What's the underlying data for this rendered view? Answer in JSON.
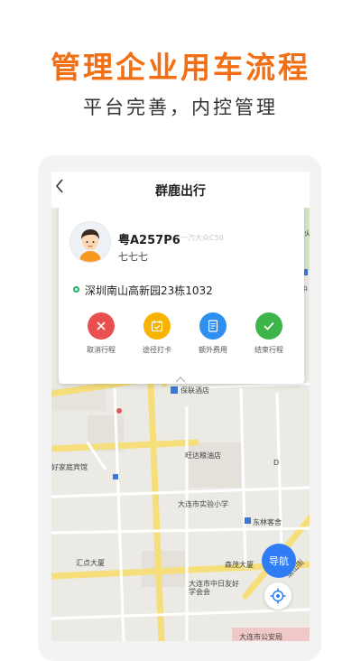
{
  "promo": {
    "headline": "管理企业用车流程",
    "subheadline": "平台完善，内控管理"
  },
  "app": {
    "title": "群鹿出行",
    "back_icon": "chevron-left-icon"
  },
  "trip_card": {
    "plate": "粤A257P6",
    "car_model": "一汽大众C50",
    "driver_name": "七七七",
    "address": "深圳南山高新园23栋1032",
    "actions": [
      {
        "label": "取消行程",
        "icon": "close-icon",
        "color": "#ea4f4f"
      },
      {
        "label": "途径打卡",
        "icon": "calendar-check-icon",
        "color": "#f6b400"
      },
      {
        "label": "额外费用",
        "icon": "receipt-icon",
        "color": "#2f8ff0"
      },
      {
        "label": "结束行程",
        "icon": "checkmark-icon",
        "color": "#3db54a"
      }
    ]
  },
  "map": {
    "labels": [
      "保联酒店",
      "旺达粮油店",
      "大连市实验小学",
      "东林客舍",
      "汇点大厦",
      "森茂大厦",
      "大连市中日友好学会会",
      "大连市公安局",
      "好家庭宾馆",
      "唐山街",
      "中",
      "连火",
      "D"
    ]
  },
  "buttons": {
    "navigate_label": "导航",
    "locate_icon": "locate-icon"
  }
}
